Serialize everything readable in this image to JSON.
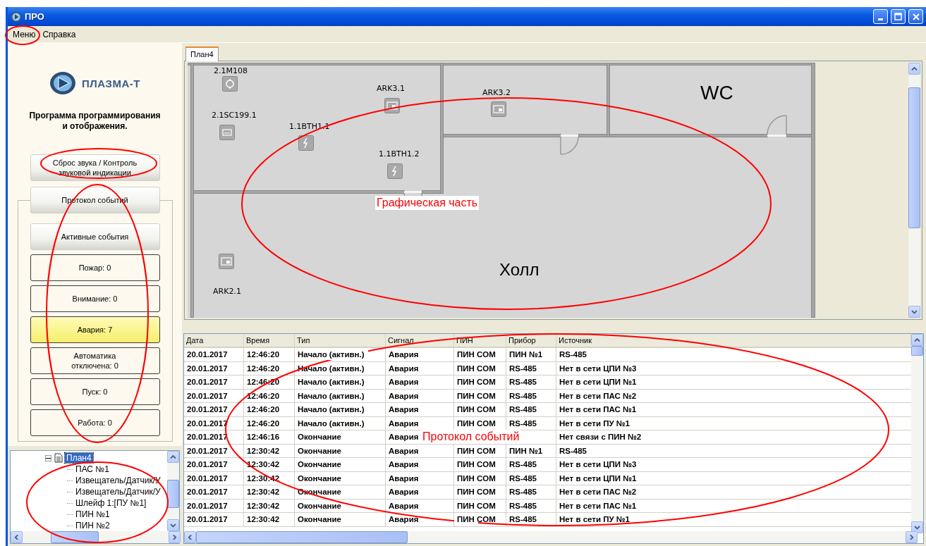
{
  "window": {
    "title": "ПРО"
  },
  "menu": [
    {
      "label": "Меню"
    },
    {
      "label": "Справка"
    }
  ],
  "sidebar": {
    "logo_text": "ПЛАЗМА-Т",
    "subtitle": "Программа программирования и отображения.",
    "sound_button": "Сброс звука / Контроль звуковой индикации",
    "protocol_button": "Протокол событий",
    "active_events_button": "Активные события",
    "counters": [
      {
        "label": "Пожар: 0",
        "active": false
      },
      {
        "label": "Внимание: 0",
        "active": false
      },
      {
        "label": "Авария: 7",
        "active": true
      },
      {
        "label": "Автоматика отключена: 0",
        "active": false
      },
      {
        "label": "Пуск: 0",
        "active": false
      },
      {
        "label": "Работа: 0",
        "active": false
      }
    ]
  },
  "tree": {
    "items": [
      {
        "label": "План4",
        "selected": true,
        "expanded": true,
        "children": [
          {
            "label": "ПАС №1",
            "selected": false
          },
          {
            "label": "Извещатель/Датчик/У",
            "selected": false
          },
          {
            "label": "Извещатель/Датчик/У",
            "selected": false
          },
          {
            "label": "Шлейф 1:[ПУ №1]",
            "selected": false
          },
          {
            "label": "ПИН №1",
            "selected": false
          },
          {
            "label": "ПИН №2",
            "selected": false
          }
        ]
      }
    ]
  },
  "plan": {
    "tabs": [
      {
        "label": "План4",
        "selected": true
      }
    ],
    "rooms": [
      {
        "label": "WC"
      },
      {
        "label": "Холл"
      }
    ],
    "devices": [
      {
        "label": "2.1M108",
        "kind": "detector"
      },
      {
        "label": "ARK3.1",
        "kind": "controller"
      },
      {
        "label": "ARK3.2",
        "kind": "controller"
      },
      {
        "label": "2.1SC199.1",
        "kind": "module"
      },
      {
        "label": "1.1BTH1.1",
        "kind": "sensor"
      },
      {
        "label": "1.1BTH1.2",
        "kind": "sensor"
      },
      {
        "label": "ARK2.1",
        "kind": "controller"
      }
    ]
  },
  "events": {
    "columns": [
      "Дата",
      "Время",
      "Тип",
      "Сигнал",
      "ПИН",
      "Прибор",
      "Источник"
    ],
    "rows": [
      {
        "cells": [
          "20.01.2017",
          "12:46:20",
          "Начало (активн.)",
          "Авария",
          "ПИН COM",
          "ПИН №1",
          "RS-485"
        ]
      },
      {
        "cells": [
          "20.01.2017",
          "12:46:20",
          "Начало (активн.)",
          "Авария",
          "ПИН COM",
          "RS-485",
          "Нет в сети ЦПИ №3"
        ]
      },
      {
        "cells": [
          "20.01.2017",
          "12:46:20",
          "Начало (активн.)",
          "Авария",
          "ПИН COM",
          "RS-485",
          "Нет в сети ЦПИ №1"
        ]
      },
      {
        "cells": [
          "20.01.2017",
          "12:46:20",
          "Начало (активн.)",
          "Авария",
          "ПИН COM",
          "RS-485",
          "Нет в сети ПАС №2"
        ]
      },
      {
        "cells": [
          "20.01.2017",
          "12:46:20",
          "Начало (активн.)",
          "Авария",
          "ПИН COM",
          "RS-485",
          "Нет в сети ПАС №1"
        ]
      },
      {
        "cells": [
          "20.01.2017",
          "12:46:20",
          "Начало (активн.)",
          "Авария",
          "ПИН COM",
          "RS-485",
          "Нет в сети ПУ №1"
        ]
      },
      {
        "cells": [
          "20.01.2017",
          "12:46:16",
          "Окончание",
          "Авария",
          null,
          null,
          "Нет связи с ПИН №2"
        ]
      },
      {
        "cells": [
          "20.01.2017",
          "12:30:42",
          "Окончание",
          "Авария",
          "ПИН COM",
          "ПИН №1",
          "RS-485"
        ]
      },
      {
        "cells": [
          "20.01.2017",
          "12:30:42",
          "Окончание",
          "Авария",
          "ПИН COM",
          "RS-485",
          "Нет в сети ЦПИ №3"
        ]
      },
      {
        "cells": [
          "20.01.2017",
          "12:30:42",
          "Окончание",
          "Авария",
          "ПИН COM",
          "RS-485",
          "Нет в сети ЦПИ №1"
        ]
      },
      {
        "cells": [
          "20.01.2017",
          "12:30:42",
          "Окончание",
          "Авария",
          "ПИН COM",
          "RS-485",
          "Нет в сети ПАС №2"
        ]
      },
      {
        "cells": [
          "20.01.2017",
          "12:30:42",
          "Окончание",
          "Авария",
          "ПИН COM",
          "RS-485",
          "Нет в сети ПАС №1"
        ]
      },
      {
        "cells": [
          "20.01.2017",
          "12:30:42",
          "Окончание",
          "Авария",
          "ПИН COM",
          "RS-485",
          "Нет в сети ПУ №1"
        ]
      }
    ]
  },
  "annotations": [
    {
      "kind": "ellipse"
    },
    {
      "kind": "ellipse"
    },
    {
      "kind": "ellipse"
    },
    {
      "kind": "ellipse"
    },
    {
      "kind": "ellipse",
      "label": "Графическая часть"
    },
    {
      "kind": "ellipse",
      "label": "Протокол событий"
    }
  ]
}
